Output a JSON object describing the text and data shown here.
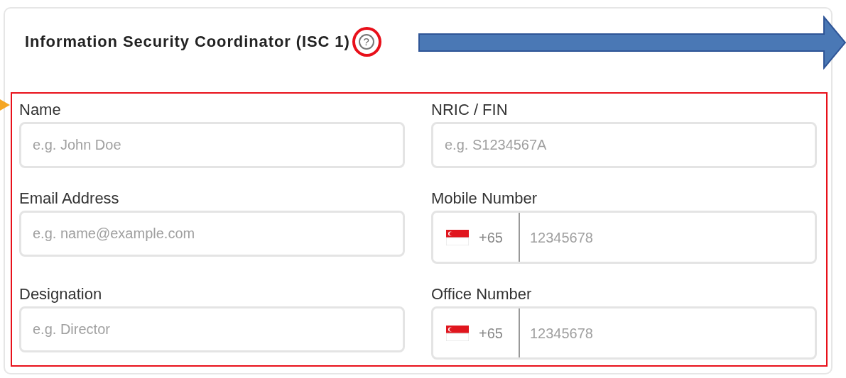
{
  "section": {
    "title": "Information Security Coordinator (ISC 1)",
    "help": "?"
  },
  "fields": [
    {
      "kind": "text",
      "label": "Name",
      "placeholder": "e.g. John Doe"
    },
    {
      "kind": "text",
      "label": "NRIC / FIN",
      "placeholder": "e.g. S1234567A"
    },
    {
      "kind": "text",
      "label": "Email Address",
      "placeholder": "e.g. name@example.com"
    },
    {
      "kind": "phone",
      "label": "Mobile Number",
      "country_code": "+65",
      "placeholder": "12345678"
    },
    {
      "kind": "text",
      "label": "Designation",
      "placeholder": "e.g. Director"
    },
    {
      "kind": "phone",
      "label": "Office Number",
      "country_code": "+65",
      "placeholder": "12345678"
    }
  ]
}
